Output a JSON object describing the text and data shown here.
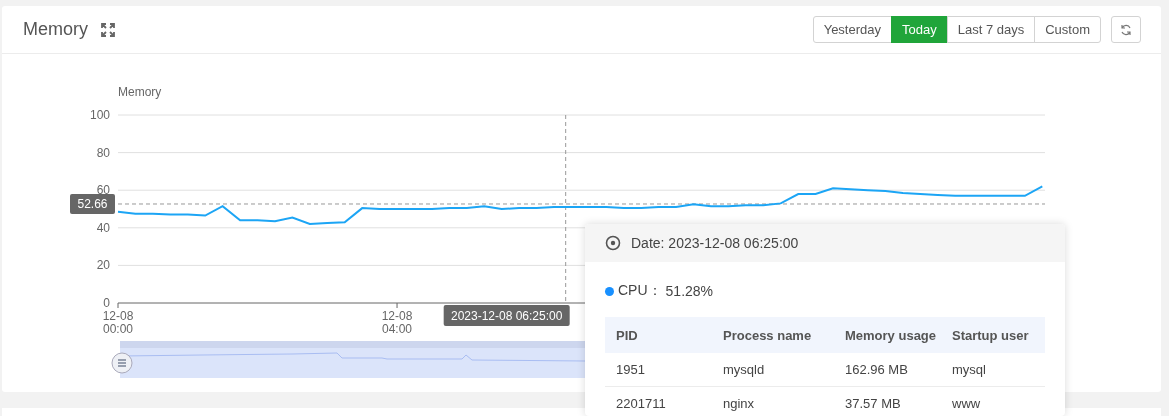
{
  "panel": {
    "title": "Memory",
    "ranges": [
      {
        "label": "Yesterday",
        "selected": false
      },
      {
        "label": "Today",
        "selected": true
      },
      {
        "label": "Last 7 days",
        "selected": false
      },
      {
        "label": "Custom",
        "selected": false
      }
    ]
  },
  "chart": {
    "chart_data": {
      "type": "line",
      "ylabel": "Memory",
      "categories": [
        "12-08 00:00",
        null,
        null,
        null,
        null,
        null,
        null,
        null,
        null,
        null,
        null,
        null,
        null,
        null,
        null,
        null,
        "12-08 04:00",
        null,
        null,
        null,
        null,
        null,
        null,
        null,
        null,
        null,
        null,
        null,
        null,
        null,
        null,
        null,
        null,
        null,
        null,
        null,
        null,
        null,
        null,
        null,
        null,
        null,
        null,
        null,
        null,
        null,
        null,
        null,
        null,
        null,
        null,
        null,
        null,
        null
      ],
      "series": [
        {
          "color": "#1ca5f5",
          "values": [
            48.5,
            47.5,
            47.5,
            47,
            47,
            46.5,
            51.5,
            44,
            44,
            43.5,
            45.5,
            42,
            42.5,
            43,
            50.5,
            50,
            50,
            50,
            50,
            50.5,
            50.5,
            51.5,
            50,
            50.5,
            50.5,
            51,
            51,
            51,
            51,
            50.5,
            50.5,
            51,
            51,
            52.5,
            51.5,
            51.5,
            52,
            52,
            53,
            58,
            58,
            61,
            60.5,
            60,
            59.5,
            58.5,
            58,
            57.5,
            57,
            57,
            57,
            57,
            57,
            62
          ]
        }
      ],
      "ylim": [
        0,
        100
      ],
      "yticks": [
        0,
        20,
        40,
        60,
        80,
        100
      ],
      "grid": true,
      "ref_lines": [
        {
          "axis": "y",
          "value": 52.66,
          "label": "52.66"
        }
      ]
    },
    "pointer_label": "2023-12-08 06:25:00"
  },
  "tooltip": {
    "date": "Date: 2023-12-08 06:25:00",
    "series": [
      {
        "label": "CPU：",
        "value": "51.28%",
        "color": "#1890ff"
      }
    ],
    "columns": [
      "PID",
      "Process name",
      "Memory usage",
      "Startup user"
    ],
    "rows": [
      [
        "1951",
        "mysqld",
        "162.96 MB",
        "mysql"
      ],
      [
        "2201711",
        "nginx",
        "37.57 MB",
        "www"
      ]
    ]
  }
}
